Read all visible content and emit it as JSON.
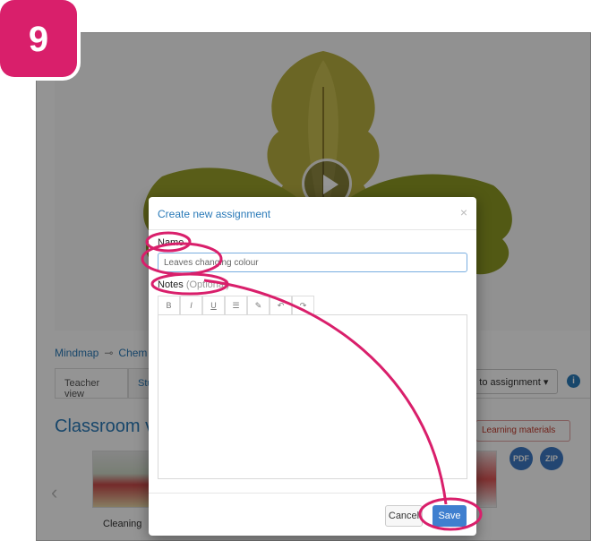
{
  "step": {
    "number": "9"
  },
  "colors": {
    "accent": "#d91f6b",
    "link": "#2a7ab8",
    "primary_button": "#3f7fcf"
  },
  "background": {
    "breadcrumb": {
      "first": "Mindmap",
      "second": "Chem"
    },
    "tabs": [
      {
        "label": "Teacher view"
      },
      {
        "label": "Stu"
      }
    ],
    "add_to_assignment": "dd to assignment ▾",
    "info_icon": "i",
    "section_title": "Classroom visu",
    "learning_materials": "Learning materials",
    "file_icons": {
      "pdf": "PDF",
      "zip": "ZIP"
    },
    "thumbnail_label": "Cleaning",
    "carousel_prev": "‹"
  },
  "modal": {
    "title": "Create new assignment",
    "close": "×",
    "name_label": "Name",
    "name_value": "Leaves changing colour",
    "notes_label": "Notes",
    "notes_optional": "(Optional)",
    "toolbar": [
      "B",
      "I",
      "U",
      "☰",
      "✎",
      "↶",
      "↷"
    ],
    "cancel": "Cancel",
    "save": "Save"
  }
}
